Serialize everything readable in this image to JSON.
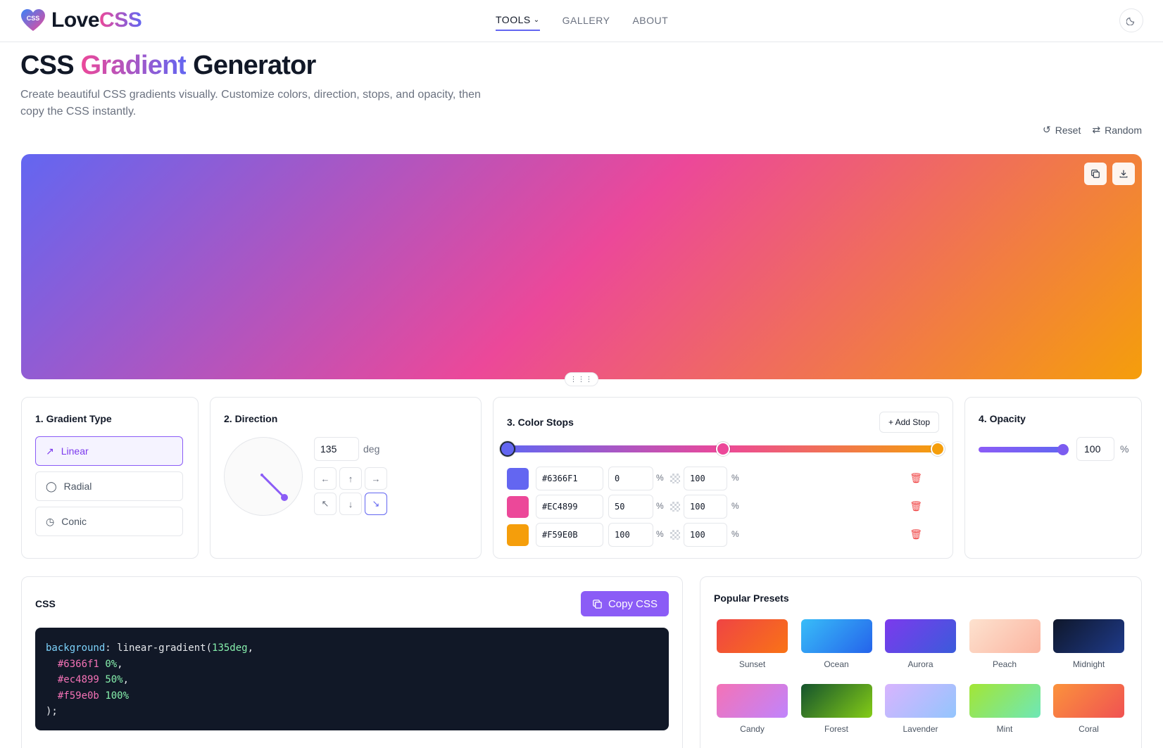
{
  "header": {
    "logo_badge": "CSS",
    "logo_part1": "Love",
    "logo_part2": "CSS",
    "nav": [
      {
        "label": "TOOLS"
      },
      {
        "label": "GALLERY"
      },
      {
        "label": "ABOUT"
      }
    ]
  },
  "page": {
    "title_part1": "CSS",
    "title_part2": "Gradient",
    "title_part3": "Generator",
    "subtitle": "Create beautiful CSS gradients visually. Customize colors, direction, stops, and opacity, then copy the CSS instantly.",
    "reset_label": "Reset",
    "random_label": "Random"
  },
  "type_panel": {
    "title": "1. Gradient Type",
    "options": [
      "Linear",
      "Radial",
      "Conic"
    ],
    "selected": "Linear"
  },
  "direction_panel": {
    "title": "2. Direction",
    "angle": "135",
    "unit": "deg"
  },
  "stops_panel": {
    "title": "3. Color Stops",
    "add_label": "+ Add Stop",
    "stops": [
      {
        "hex": "#6366F1",
        "color": "#6366f1",
        "position": "0",
        "opacity": "100"
      },
      {
        "hex": "#EC4899",
        "color": "#ec4899",
        "position": "50",
        "opacity": "100"
      },
      {
        "hex": "#F59E0B",
        "color": "#f59e0b",
        "position": "100",
        "opacity": "100"
      }
    ],
    "pct_symbol": "%"
  },
  "opacity_panel": {
    "title": "4. Opacity",
    "value": "100",
    "unit": "%"
  },
  "css_panel": {
    "title": "CSS",
    "copy_label": "Copy CSS",
    "code": {
      "prop": "background",
      "func": "linear-gradient(",
      "angle": "135deg",
      "stops": [
        {
          "hex": "#6366f1",
          "pos": "0%"
        },
        {
          "hex": "#ec4899",
          "pos": "50%"
        },
        {
          "hex": "#f59e0b",
          "pos": "100%"
        }
      ],
      "close": ");"
    }
  },
  "presets_panel": {
    "title": "Popular Presets",
    "presets": [
      {
        "name": "Sunset",
        "from": "#ef4444",
        "to": "#f97316"
      },
      {
        "name": "Ocean",
        "from": "#38bdf8",
        "to": "#2563eb"
      },
      {
        "name": "Aurora",
        "from": "#7c3aed",
        "to": "#3b5bdb"
      },
      {
        "name": "Peach",
        "from": "#fde2cf",
        "to": "#fbb4a0"
      },
      {
        "name": "Midnight",
        "from": "#0f172a",
        "to": "#1e3a8a"
      },
      {
        "name": "Candy",
        "from": "#f472b6",
        "to": "#c084fc"
      },
      {
        "name": "Forest",
        "from": "#14532d",
        "to": "#84cc16"
      },
      {
        "name": "Lavender",
        "from": "#d8b4fe",
        "to": "#93c5fd"
      },
      {
        "name": "Mint",
        "from": "#a3e635",
        "to": "#6ee7b7"
      },
      {
        "name": "Coral",
        "from": "#fb923c",
        "to": "#f05252"
      }
    ]
  },
  "colors": {
    "accent": "#8b5cf6",
    "indigo": "#6366f1",
    "danger": "#ef4444"
  }
}
